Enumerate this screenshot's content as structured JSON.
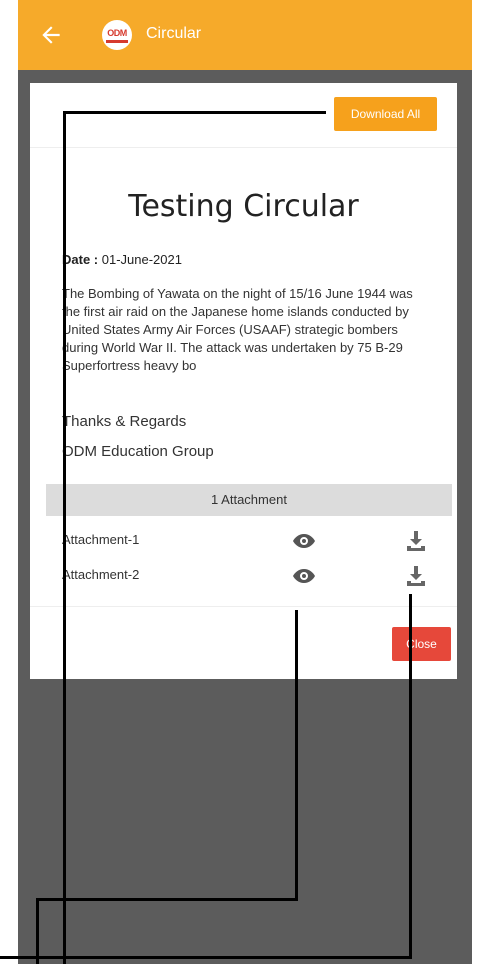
{
  "header": {
    "title": "Circular",
    "logo_text": "ODM"
  },
  "toolbar": {
    "download_all_label": "Download All"
  },
  "circular": {
    "title": "Testing Circular",
    "date_label": "Date :",
    "date_value": "01-June-2021",
    "body": "The Bombing of Yawata on the night of 15/16 June 1944 was the first air raid on the Japanese home islands conducted by United States Army Air Forces (USAAF) strategic bombers during World War II. The attack was undertaken by 75 B-29 Superfortress heavy bo",
    "thanks": "Thanks & Regards",
    "signature": "ODM Education Group"
  },
  "attachments": {
    "header": "1 Attachment",
    "items": [
      {
        "name": "Attachment-1"
      },
      {
        "name": "Attachment-2"
      }
    ]
  },
  "footer": {
    "close_label": "Close"
  },
  "colors": {
    "appbar": "#f6aa2a",
    "download_all": "#f6a11c",
    "close": "#e6483a",
    "backdrop": "#5c5c5c"
  }
}
